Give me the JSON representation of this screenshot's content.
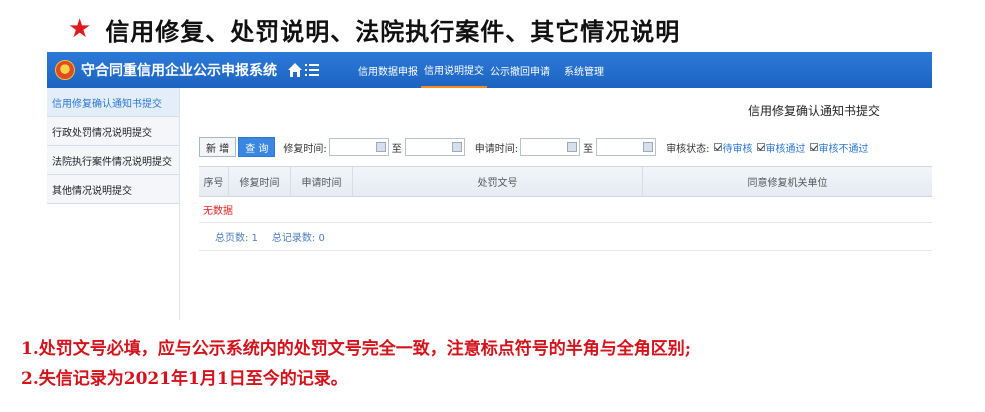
{
  "slide": {
    "star": "★",
    "title": "信用修复、处罚说明、法院执行案件、其它情况说明"
  },
  "app": {
    "system_title": "守合同重信用企业公示申报系统",
    "nav": [
      {
        "label": "信用数据申报"
      },
      {
        "label": "信用说明提交"
      },
      {
        "label": "公示撤回申请"
      },
      {
        "label": "系统管理"
      }
    ],
    "active_nav": "信用说明提交"
  },
  "sidebar": {
    "items": [
      {
        "label": "信用修复确认通知书提交"
      },
      {
        "label": "行政处罚情况说明提交"
      },
      {
        "label": "法院执行案件情况说明提交"
      },
      {
        "label": "其他情况说明提交"
      }
    ]
  },
  "main": {
    "form_title": "信用修复确认通知书提交",
    "toolbar": {
      "new_label": "新 增",
      "query_label": "查 询",
      "repair_time_label": "修复时间:",
      "to1": "至",
      "apply_time_label": "申请时间:",
      "to2": "至",
      "status_label": "审核状态:",
      "statuses": [
        {
          "label": "待审核"
        },
        {
          "label": "审核通过"
        },
        {
          "label": "审核不通过"
        }
      ]
    },
    "table": {
      "columns": [
        "序号",
        "修复时间",
        "申请时间",
        "处罚文号",
        "同意修复机关单位"
      ],
      "empty_text": "无数据",
      "total_pages": "总页数: 1",
      "total_records": "总记录数: 0"
    }
  },
  "notes": [
    "1.处罚文号必填，应与公示系统内的处罚文号完全一致，注意标点符号的半角与全角区别;",
    "2.失信记录为2021年1月1日至今的记录。"
  ],
  "colors": {
    "topbar": "#1d63c0",
    "accent": "#2b77d4",
    "active_underline": "#ff8a1c",
    "note_red": "#d3121b"
  }
}
